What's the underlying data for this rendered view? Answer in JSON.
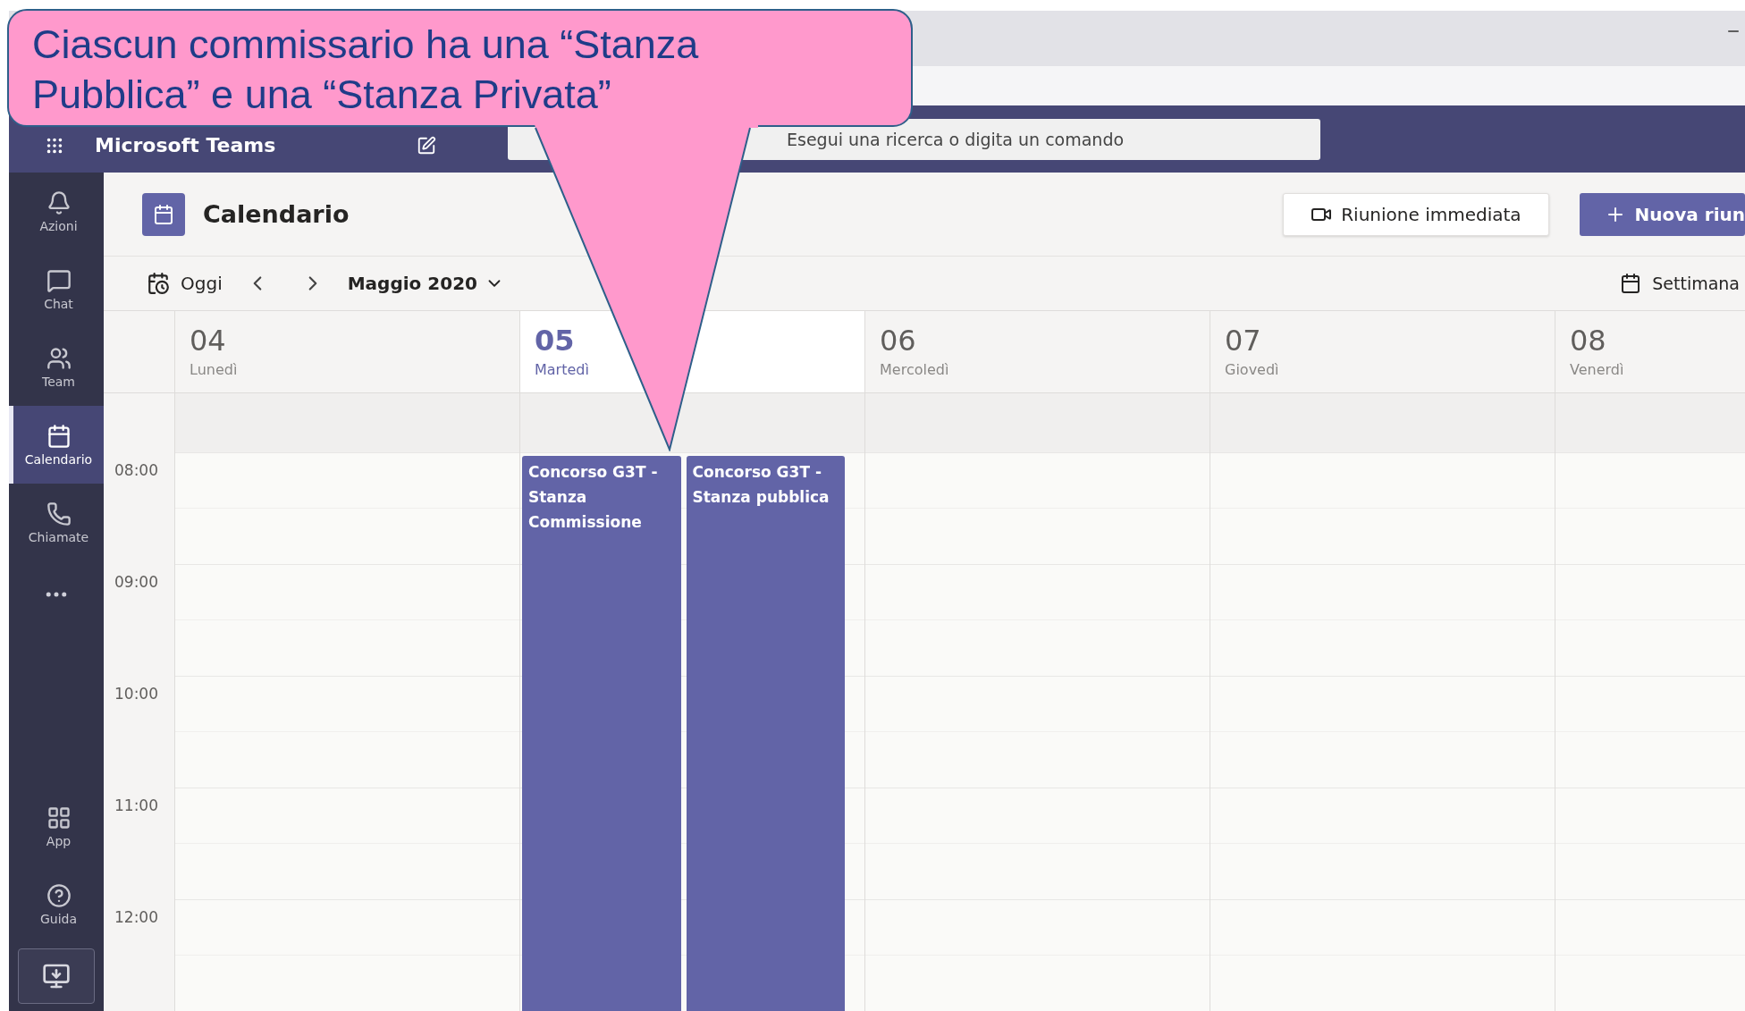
{
  "callout": {
    "text": "Ciascun commissario ha una “Stanza Pubblica” e una “Stanza Privata”"
  },
  "app_header": {
    "title": "Microsoft Teams",
    "search": {
      "placeholder": "Esegui una ricerca o digita un comando"
    }
  },
  "sidebar": {
    "items": [
      {
        "label": "Azioni",
        "selected": false
      },
      {
        "label": "Chat",
        "selected": false
      },
      {
        "label": "Team",
        "selected": false
      },
      {
        "label": "Calendario",
        "selected": true
      },
      {
        "label": "Chiamate",
        "selected": false
      }
    ],
    "bottom_items": [
      {
        "label": "App"
      },
      {
        "label": "Guida"
      }
    ]
  },
  "page": {
    "title": "Calendario",
    "buttons": [
      {
        "label": "Riunione immediata",
        "kind": "secondary"
      },
      {
        "label": "Nuova riun",
        "kind": "primary"
      }
    ]
  },
  "toolbar": {
    "today": "Oggi",
    "month": "Maggio 2020",
    "view": "Settimana"
  },
  "days": [
    {
      "number": "04",
      "name": "Lunedì",
      "selected": false
    },
    {
      "number": "05",
      "name": "Martedì",
      "selected": true,
      "events": [
        {
          "title": "Concorso G3T - Stanza Commissione"
        },
        {
          "title": "Concorso G3T - Stanza pubblica"
        }
      ]
    },
    {
      "number": "06",
      "name": "Mercoledì",
      "selected": false
    },
    {
      "number": "07",
      "name": "Giovedì",
      "selected": false
    },
    {
      "number": "08",
      "name": "Venerdì",
      "selected": false
    }
  ],
  "hours": [
    "08:00",
    "09:00",
    "10:00",
    "11:00",
    "12:00"
  ]
}
